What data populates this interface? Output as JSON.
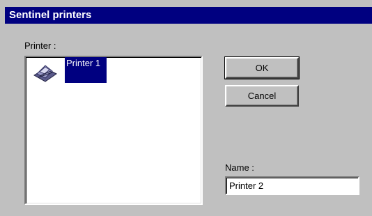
{
  "window": {
    "title": "Sentinel printers"
  },
  "printer_list": {
    "label": "Printer :",
    "items": [
      {
        "label": "Printer 1",
        "icon": "printer-icon",
        "selected": true
      }
    ]
  },
  "buttons": {
    "ok_label": "OK",
    "cancel_label": "Cancel"
  },
  "name": {
    "label": "Name :",
    "value": "Printer 2"
  },
  "colors": {
    "titlebar": "#000080",
    "selection": "#000080",
    "face": "#c0c0c0"
  }
}
